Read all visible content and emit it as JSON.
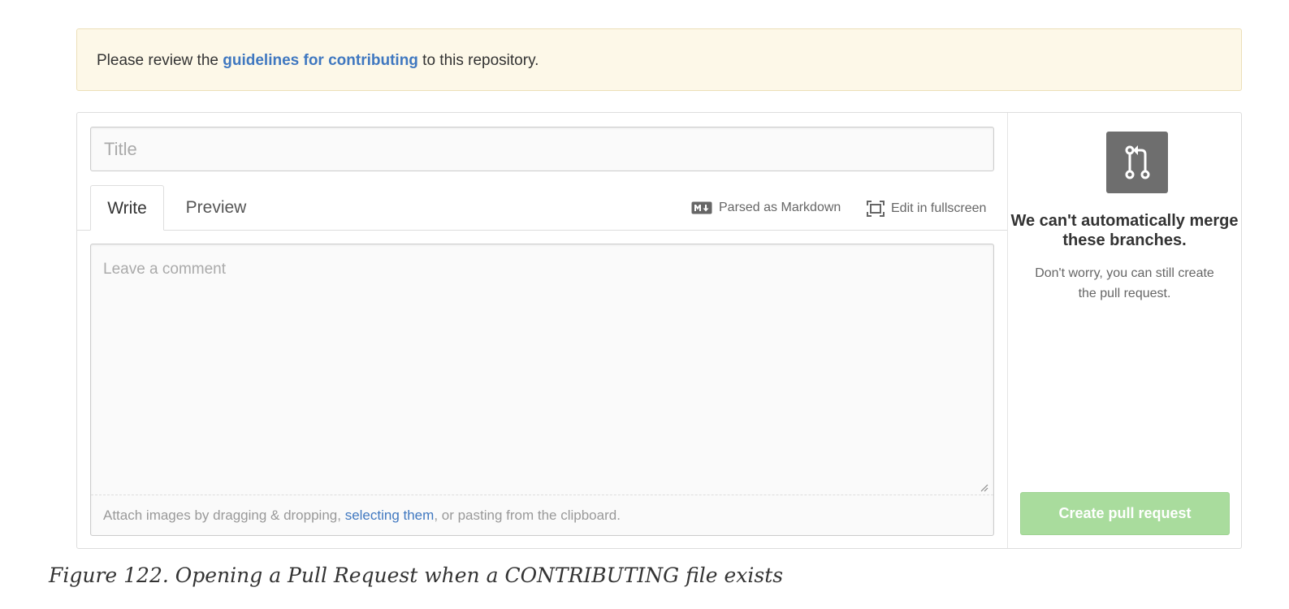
{
  "notice": {
    "prefix": "Please review the ",
    "link": "guidelines for contributing",
    "suffix": " to this repository."
  },
  "form": {
    "title_placeholder": "Title",
    "tabs": [
      {
        "label": "Write",
        "active": true
      },
      {
        "label": "Preview",
        "active": false
      }
    ],
    "markdown_note": "Parsed as Markdown",
    "fullscreen_label": "Edit in fullscreen",
    "comment_placeholder": "Leave a comment",
    "attach_hint": {
      "prefix": "Attach images by dragging & dropping, ",
      "link": "selecting them",
      "suffix": ", or pasting from the clipboard."
    }
  },
  "sidebar": {
    "icon": "git-pull-request-icon",
    "heading": "We can't automatically merge these branches.",
    "subtext": "Don't worry, you can still create the pull request.",
    "create_button": "Create pull request"
  },
  "colors": {
    "link": "#4078c0",
    "notice_bg": "#fdf8e8",
    "button_bg": "#a9dc9d",
    "icon_bg": "#6e6e6e"
  },
  "caption": "Figure 122. Opening a Pull Request when a CONTRIBUTING file exists"
}
